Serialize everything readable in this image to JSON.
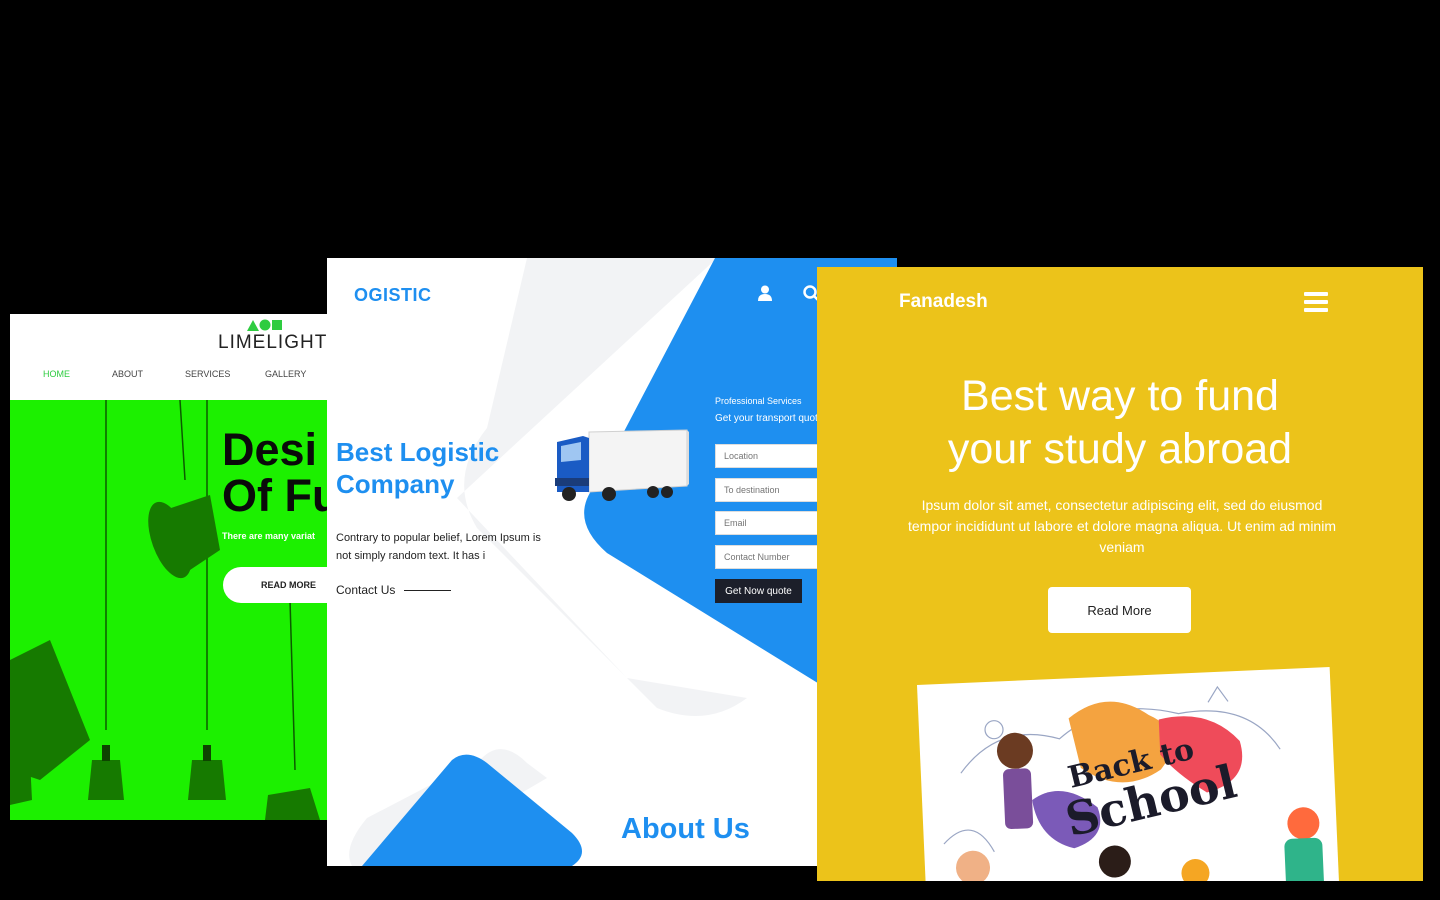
{
  "limelight": {
    "logo_text": "LIMELIGHT",
    "nav": [
      "HOME",
      "ABOUT",
      "SERVICES",
      "GALLERY"
    ],
    "active_nav_color": "#2ecc40",
    "hero_color": "#1cf000",
    "headline_line1": "Desi",
    "headline_line2": "Of Fu",
    "subtext": "There are many variat",
    "read_more": "READ MORE"
  },
  "logistic": {
    "brand": "OGISTIC",
    "accent_color": "#1e8ff0",
    "icons": [
      "user-icon",
      "search-icon",
      "menu-icon"
    ],
    "title_line1": "Best Logistic",
    "title_line2": "Company",
    "description": "Contrary to popular belief, Lorem Ipsum is not simply random text. It has i",
    "contact_link": "Contact Us",
    "form_kicker": "Professional Services",
    "form_title": "Get your transport quote",
    "fields": {
      "location": "Location",
      "destination": "To destination",
      "email": "Email",
      "contact_number": "Contact Number"
    },
    "quote_button": "Get Now quote",
    "about_heading": "About Us"
  },
  "fanadesh": {
    "brand": "Fanadesh",
    "bg_color": "#ecc31a",
    "headline_line1": "Best way to fund",
    "headline_line2": "your study abroad",
    "body": "Ipsum dolor sit amet, consectetur adipiscing elit, sed do eiusmod tempor incididunt ut labore et dolore magna aliqua. Ut enim ad minim veniam",
    "read_more": "Read More",
    "poster_line1": "Back to",
    "poster_line2": "School"
  }
}
